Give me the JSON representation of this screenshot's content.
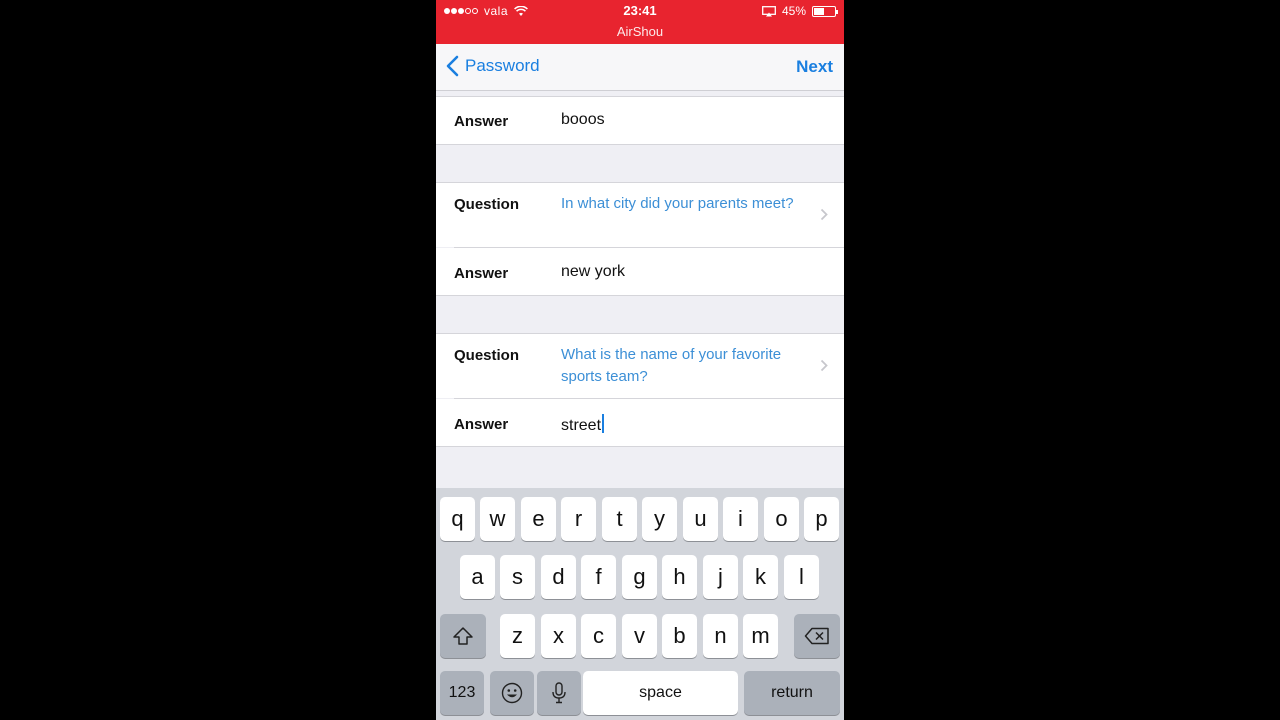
{
  "status_bar": {
    "carrier": "vala",
    "time": "23:41",
    "recorder": "AirShou",
    "battery": "45%"
  },
  "nav": {
    "back_label": "Password",
    "next_label": "Next"
  },
  "form": {
    "answer_label": "Answer",
    "question_label": "Question",
    "answer1": "booos",
    "question2": "In what city did your parents meet?",
    "answer2": "new york",
    "question3": "What is the name of your favorite sports team?",
    "answer3": "street"
  },
  "keyboard": {
    "row1": [
      "q",
      "w",
      "e",
      "r",
      "t",
      "y",
      "u",
      "i",
      "o",
      "p"
    ],
    "row2": [
      "a",
      "s",
      "d",
      "f",
      "g",
      "h",
      "j",
      "k",
      "l"
    ],
    "row3": [
      "z",
      "x",
      "c",
      "v",
      "b",
      "n",
      "m"
    ],
    "numbers_label": "123",
    "space_label": "space",
    "return_label": "return"
  },
  "icons": {
    "back": "chevron-left-icon",
    "shift": "shift-icon",
    "delete": "delete-icon",
    "emoji": "emoji-icon",
    "mic": "microphone-icon",
    "wifi": "wifi-icon",
    "airplay": "airplay-icon",
    "battery": "battery-icon"
  },
  "colors": {
    "status_bar": "#e8242f",
    "accent": "#1a7fe0",
    "question_text": "#3c8fd6"
  }
}
